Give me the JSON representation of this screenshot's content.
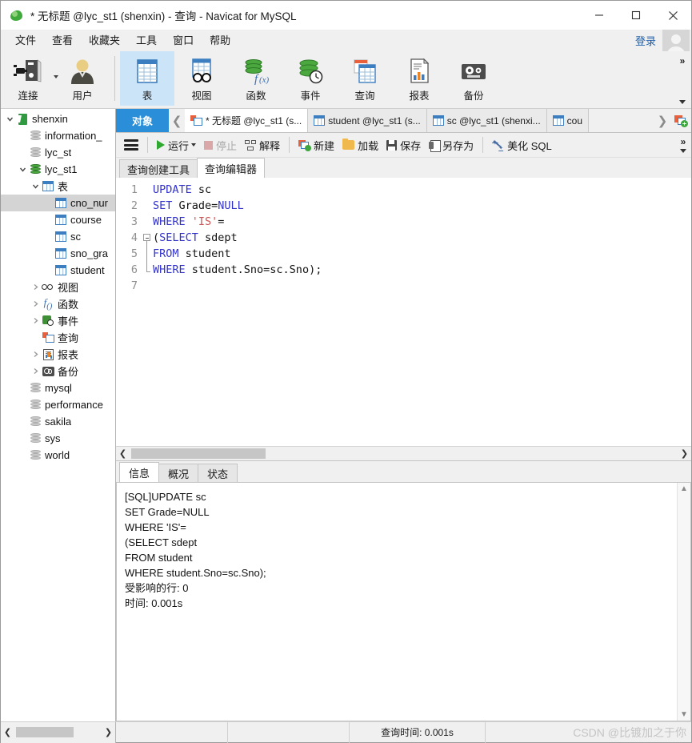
{
  "window": {
    "title": "* 无标题 @lyc_st1 (shenxin) - 查询 - Navicat for MySQL",
    "minimize": "—",
    "maximize": "▢",
    "close": "✕"
  },
  "menubar": {
    "items": [
      "文件",
      "查看",
      "收藏夹",
      "工具",
      "窗口",
      "帮助"
    ],
    "login": "登录"
  },
  "ribbon": {
    "buttons": [
      {
        "label": "连接",
        "icon": "connection-icon",
        "selected": false,
        "has_caret": true
      },
      {
        "label": "用户",
        "icon": "user-icon",
        "selected": false,
        "has_caret": false
      },
      {
        "label": "表",
        "icon": "table-icon",
        "selected": true,
        "has_caret": false
      },
      {
        "label": "视图",
        "icon": "view-icon",
        "selected": false,
        "has_caret": false
      },
      {
        "label": "函数",
        "icon": "function-icon",
        "selected": false,
        "has_caret": false
      },
      {
        "label": "事件",
        "icon": "event-icon",
        "selected": false,
        "has_caret": false
      },
      {
        "label": "查询",
        "icon": "query-icon",
        "selected": false,
        "has_caret": false
      },
      {
        "label": "报表",
        "icon": "report-icon",
        "selected": false,
        "has_caret": false
      },
      {
        "label": "备份",
        "icon": "backup-icon",
        "selected": false,
        "has_caret": false
      }
    ],
    "overflow": "»"
  },
  "sidebar": {
    "tree": [
      {
        "label": "shenxin",
        "indent": 0,
        "icon": "connection-icon",
        "twisty": "open",
        "selected": false
      },
      {
        "label": "information_",
        "indent": 1,
        "icon": "db-icon",
        "twisty": "none",
        "selected": false
      },
      {
        "label": "lyc_st",
        "indent": 1,
        "icon": "db-icon",
        "twisty": "none",
        "selected": false
      },
      {
        "label": "lyc_st1",
        "indent": 1,
        "icon": "db-green-icon",
        "twisty": "open",
        "selected": false
      },
      {
        "label": "表",
        "indent": 2,
        "icon": "table-icon",
        "twisty": "open",
        "selected": false
      },
      {
        "label": "cno_nur",
        "indent": 3,
        "icon": "table-icon",
        "twisty": "none",
        "selected": true
      },
      {
        "label": "course",
        "indent": 3,
        "icon": "table-icon",
        "twisty": "none",
        "selected": false
      },
      {
        "label": "sc",
        "indent": 3,
        "icon": "table-icon",
        "twisty": "none",
        "selected": false
      },
      {
        "label": "sno_gra",
        "indent": 3,
        "icon": "table-icon",
        "twisty": "none",
        "selected": false
      },
      {
        "label": "student",
        "indent": 3,
        "icon": "table-icon",
        "twisty": "none",
        "selected": false
      },
      {
        "label": "视图",
        "indent": 2,
        "icon": "view-icon",
        "twisty": "closed",
        "selected": false
      },
      {
        "label": "函数",
        "indent": 2,
        "icon": "function-icon",
        "twisty": "closed",
        "selected": false
      },
      {
        "label": "事件",
        "indent": 2,
        "icon": "event-icon",
        "twisty": "closed",
        "selected": false
      },
      {
        "label": "查询",
        "indent": 2,
        "icon": "query-icon",
        "twisty": "none",
        "selected": false
      },
      {
        "label": "报表",
        "indent": 2,
        "icon": "report-icon",
        "twisty": "closed",
        "selected": false
      },
      {
        "label": "备份",
        "indent": 2,
        "icon": "backup-icon",
        "twisty": "closed",
        "selected": false
      },
      {
        "label": "mysql",
        "indent": 1,
        "icon": "db-icon",
        "twisty": "none",
        "selected": false
      },
      {
        "label": "performance",
        "indent": 1,
        "icon": "db-icon",
        "twisty": "none",
        "selected": false
      },
      {
        "label": "sakila",
        "indent": 1,
        "icon": "db-icon",
        "twisty": "none",
        "selected": false
      },
      {
        "label": "sys",
        "indent": 1,
        "icon": "db-icon",
        "twisty": "none",
        "selected": false
      },
      {
        "label": "world",
        "indent": 1,
        "icon": "db-icon",
        "twisty": "none",
        "selected": false
      }
    ]
  },
  "tabbar": {
    "object_tab": "对象",
    "scroll_left": "❮",
    "scroll_right": "❯",
    "tabs": [
      {
        "label": "* 无标题 @lyc_st1 (s...",
        "icon": "query-icon",
        "active": true
      },
      {
        "label": "student @lyc_st1 (s...",
        "icon": "table-icon",
        "active": false
      },
      {
        "label": "sc @lyc_st1 (shenxi...",
        "icon": "table-icon",
        "active": false
      },
      {
        "label": "cou",
        "icon": "table-icon",
        "active": false
      }
    ],
    "add_tab_icon": "new-query-tab-icon"
  },
  "query_toolbar": {
    "menu_icon": "hamburger-icon",
    "run": "运行",
    "run_caret": "▾",
    "stop": "停止",
    "explain": "解释",
    "new": "新建",
    "load": "加载",
    "save": "保存",
    "save_as": "另存为",
    "beautify": "美化 SQL",
    "overflow": "»"
  },
  "sub_tabs": [
    {
      "label": "查询创建工具",
      "active": false
    },
    {
      "label": "查询编辑器",
      "active": true
    }
  ],
  "editor": {
    "line_numbers": [
      "1",
      "2",
      "3",
      "4",
      "5",
      "6",
      "7"
    ],
    "lines": [
      [
        {
          "t": "UPDATE",
          "c": "kw"
        },
        {
          "t": " sc",
          "c": "pl"
        }
      ],
      [
        {
          "t": "SET",
          "c": "kw"
        },
        {
          "t": " Grade=",
          "c": "pl"
        },
        {
          "t": "NULL",
          "c": "kw"
        }
      ],
      [
        {
          "t": "WHERE",
          "c": "kw"
        },
        {
          "t": " ",
          "c": "pl"
        },
        {
          "t": "'IS'",
          "c": "str"
        },
        {
          "t": "=",
          "c": "pl"
        }
      ],
      [
        {
          "t": "(",
          "c": "pl"
        },
        {
          "t": "SELECT",
          "c": "kw"
        },
        {
          "t": " sdept",
          "c": "pl"
        }
      ],
      [
        {
          "t": "FROM",
          "c": "kw"
        },
        {
          "t": " student",
          "c": "pl"
        }
      ],
      [
        {
          "t": "WHERE",
          "c": "kw"
        },
        {
          "t": " student.Sno=sc.Sno);",
          "c": "pl"
        }
      ],
      []
    ]
  },
  "results": {
    "tabs": [
      {
        "label": "信息",
        "active": true
      },
      {
        "label": "概况",
        "active": false
      },
      {
        "label": "状态",
        "active": false
      }
    ],
    "message": "[SQL]UPDATE sc\nSET Grade=NULL\nWHERE 'IS'=\n(SELECT sdept\nFROM student\nWHERE student.Sno=sc.Sno);\n受影响的行: 0\n时间: 0.001s"
  },
  "statusbar": {
    "query_time": "查询时间: 0.001s",
    "watermark": "CSDN @比镀加之于你"
  },
  "colors": {
    "accent_blue": "#2a8fd8",
    "ribbon_selected": "#cce4f7",
    "keyword_blue": "#3333cc",
    "string_red": "#cc5555",
    "green": "#3fa93b",
    "link_blue": "#1f5ea8"
  }
}
